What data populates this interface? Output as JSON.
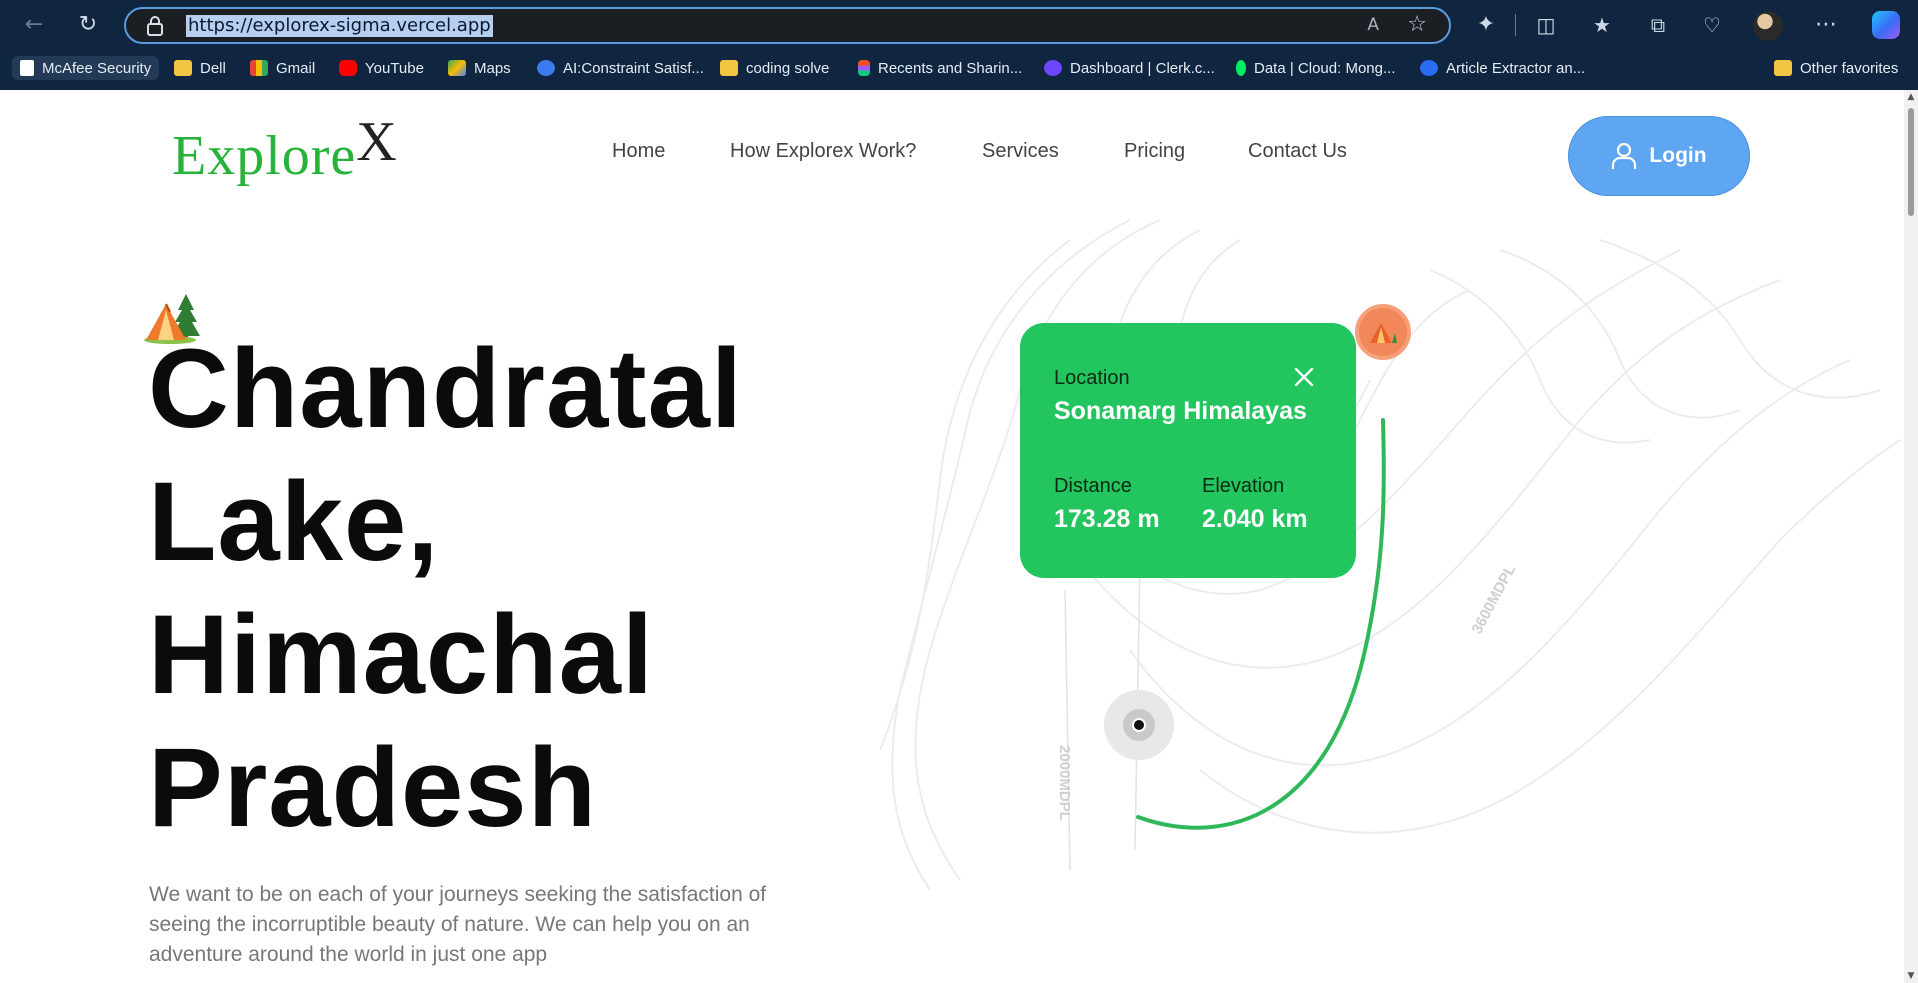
{
  "browser": {
    "url": "https://explorex-sigma.vercel.app",
    "read_aloud_label": "A",
    "bookmarks": [
      "McAfee Security",
      "Dell",
      "Gmail",
      "YouTube",
      "Maps",
      "AI:Constraint Satisf...",
      "coding solve",
      "Recents and Sharin...",
      "Dashboard | Clerk.c...",
      "Data | Cloud: Mong...",
      "Article Extractor an...",
      "Other favorites"
    ]
  },
  "site": {
    "logo_main": "Explore",
    "logo_x": "X",
    "nav": [
      "Home",
      "How Explorex Work?",
      "Services",
      "Pricing",
      "Contact Us"
    ],
    "login_label": "Login"
  },
  "hero": {
    "headline_lines": [
      "Chandratal",
      "Lake,",
      "Himachal",
      "Pradesh"
    ],
    "description": "We want to be on each of your journeys seeking the satisfaction of seeing the incorruptible beauty of nature. We can help you on an adventure around the world in just one app"
  },
  "map_card": {
    "location_label": "Location",
    "location_value": "Sonamarg Himalayas",
    "distance_label": "Distance",
    "distance_value": "173.28 m",
    "elevation_label": "Elevation",
    "elevation_value": "2.040 km"
  },
  "map_labels": {
    "contour_a": "3600MDPL",
    "contour_b": "2000MDPL"
  },
  "colors": {
    "accent_green": "#22c55e",
    "route_green": "#2fb85a",
    "login_blue": "#5ea6f2",
    "pin_orange": "#f2885a"
  }
}
